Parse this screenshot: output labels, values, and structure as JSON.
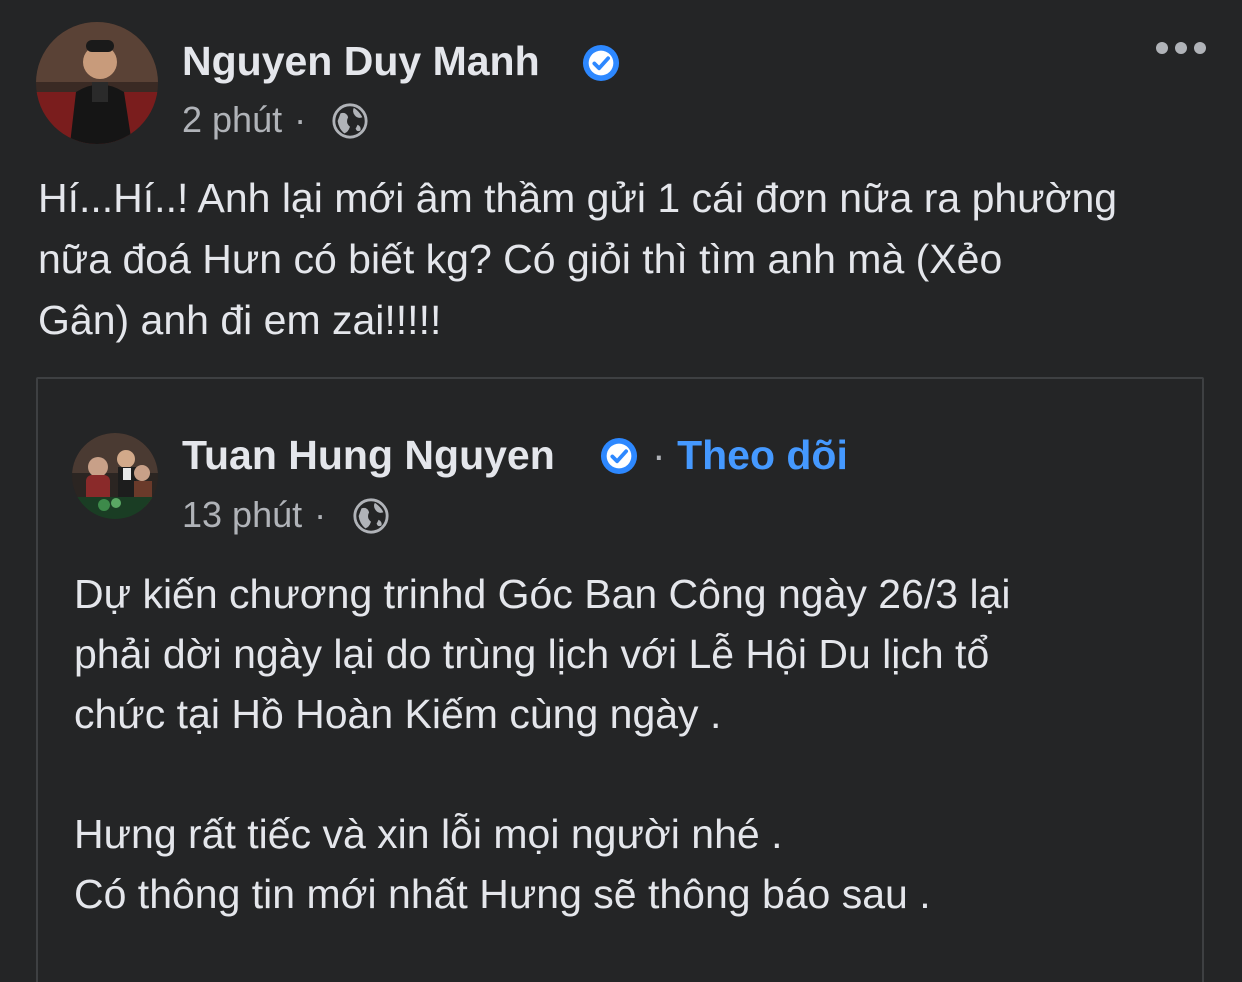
{
  "post": {
    "author": "Nguyen Duy Manh",
    "time": "2 phút",
    "separator": "·",
    "text": "Hí...Hí..! Anh lại mới âm thầm gửi 1 cái đơn nữa ra phường\nnữa đoá Hưn có biết kg? Có giỏi thì tìm anh mà (Xẻo\nGân) anh đi em zai!!!!!"
  },
  "shared": {
    "author": "Tuan Hung Nguyen",
    "separator": "·",
    "follow_label": "Theo dõi",
    "time": "13 phút",
    "text": "Dự kiến chương trinhd Góc Ban Công ngày 26/3 lại\nphải dời ngày lại do trùng lịch với Lễ Hội Du lịch tổ\nchức tại Hồ Hoàn Kiếm cùng ngày .\n\nHưng rất tiếc và xin lỗi mọi người nhé .\nCó thông tin mới nhất Hưng sẽ thông báo sau ."
  },
  "icons": {
    "verified": "verified-badge-icon",
    "audience": "globe-icon",
    "more": "more-options-icon"
  },
  "colors": {
    "background": "#242526",
    "text_primary": "#e4e6eb",
    "text_secondary": "#b0b3b8",
    "link": "#4599ff",
    "verified": "#2d88ff",
    "border": "#3e4042"
  }
}
